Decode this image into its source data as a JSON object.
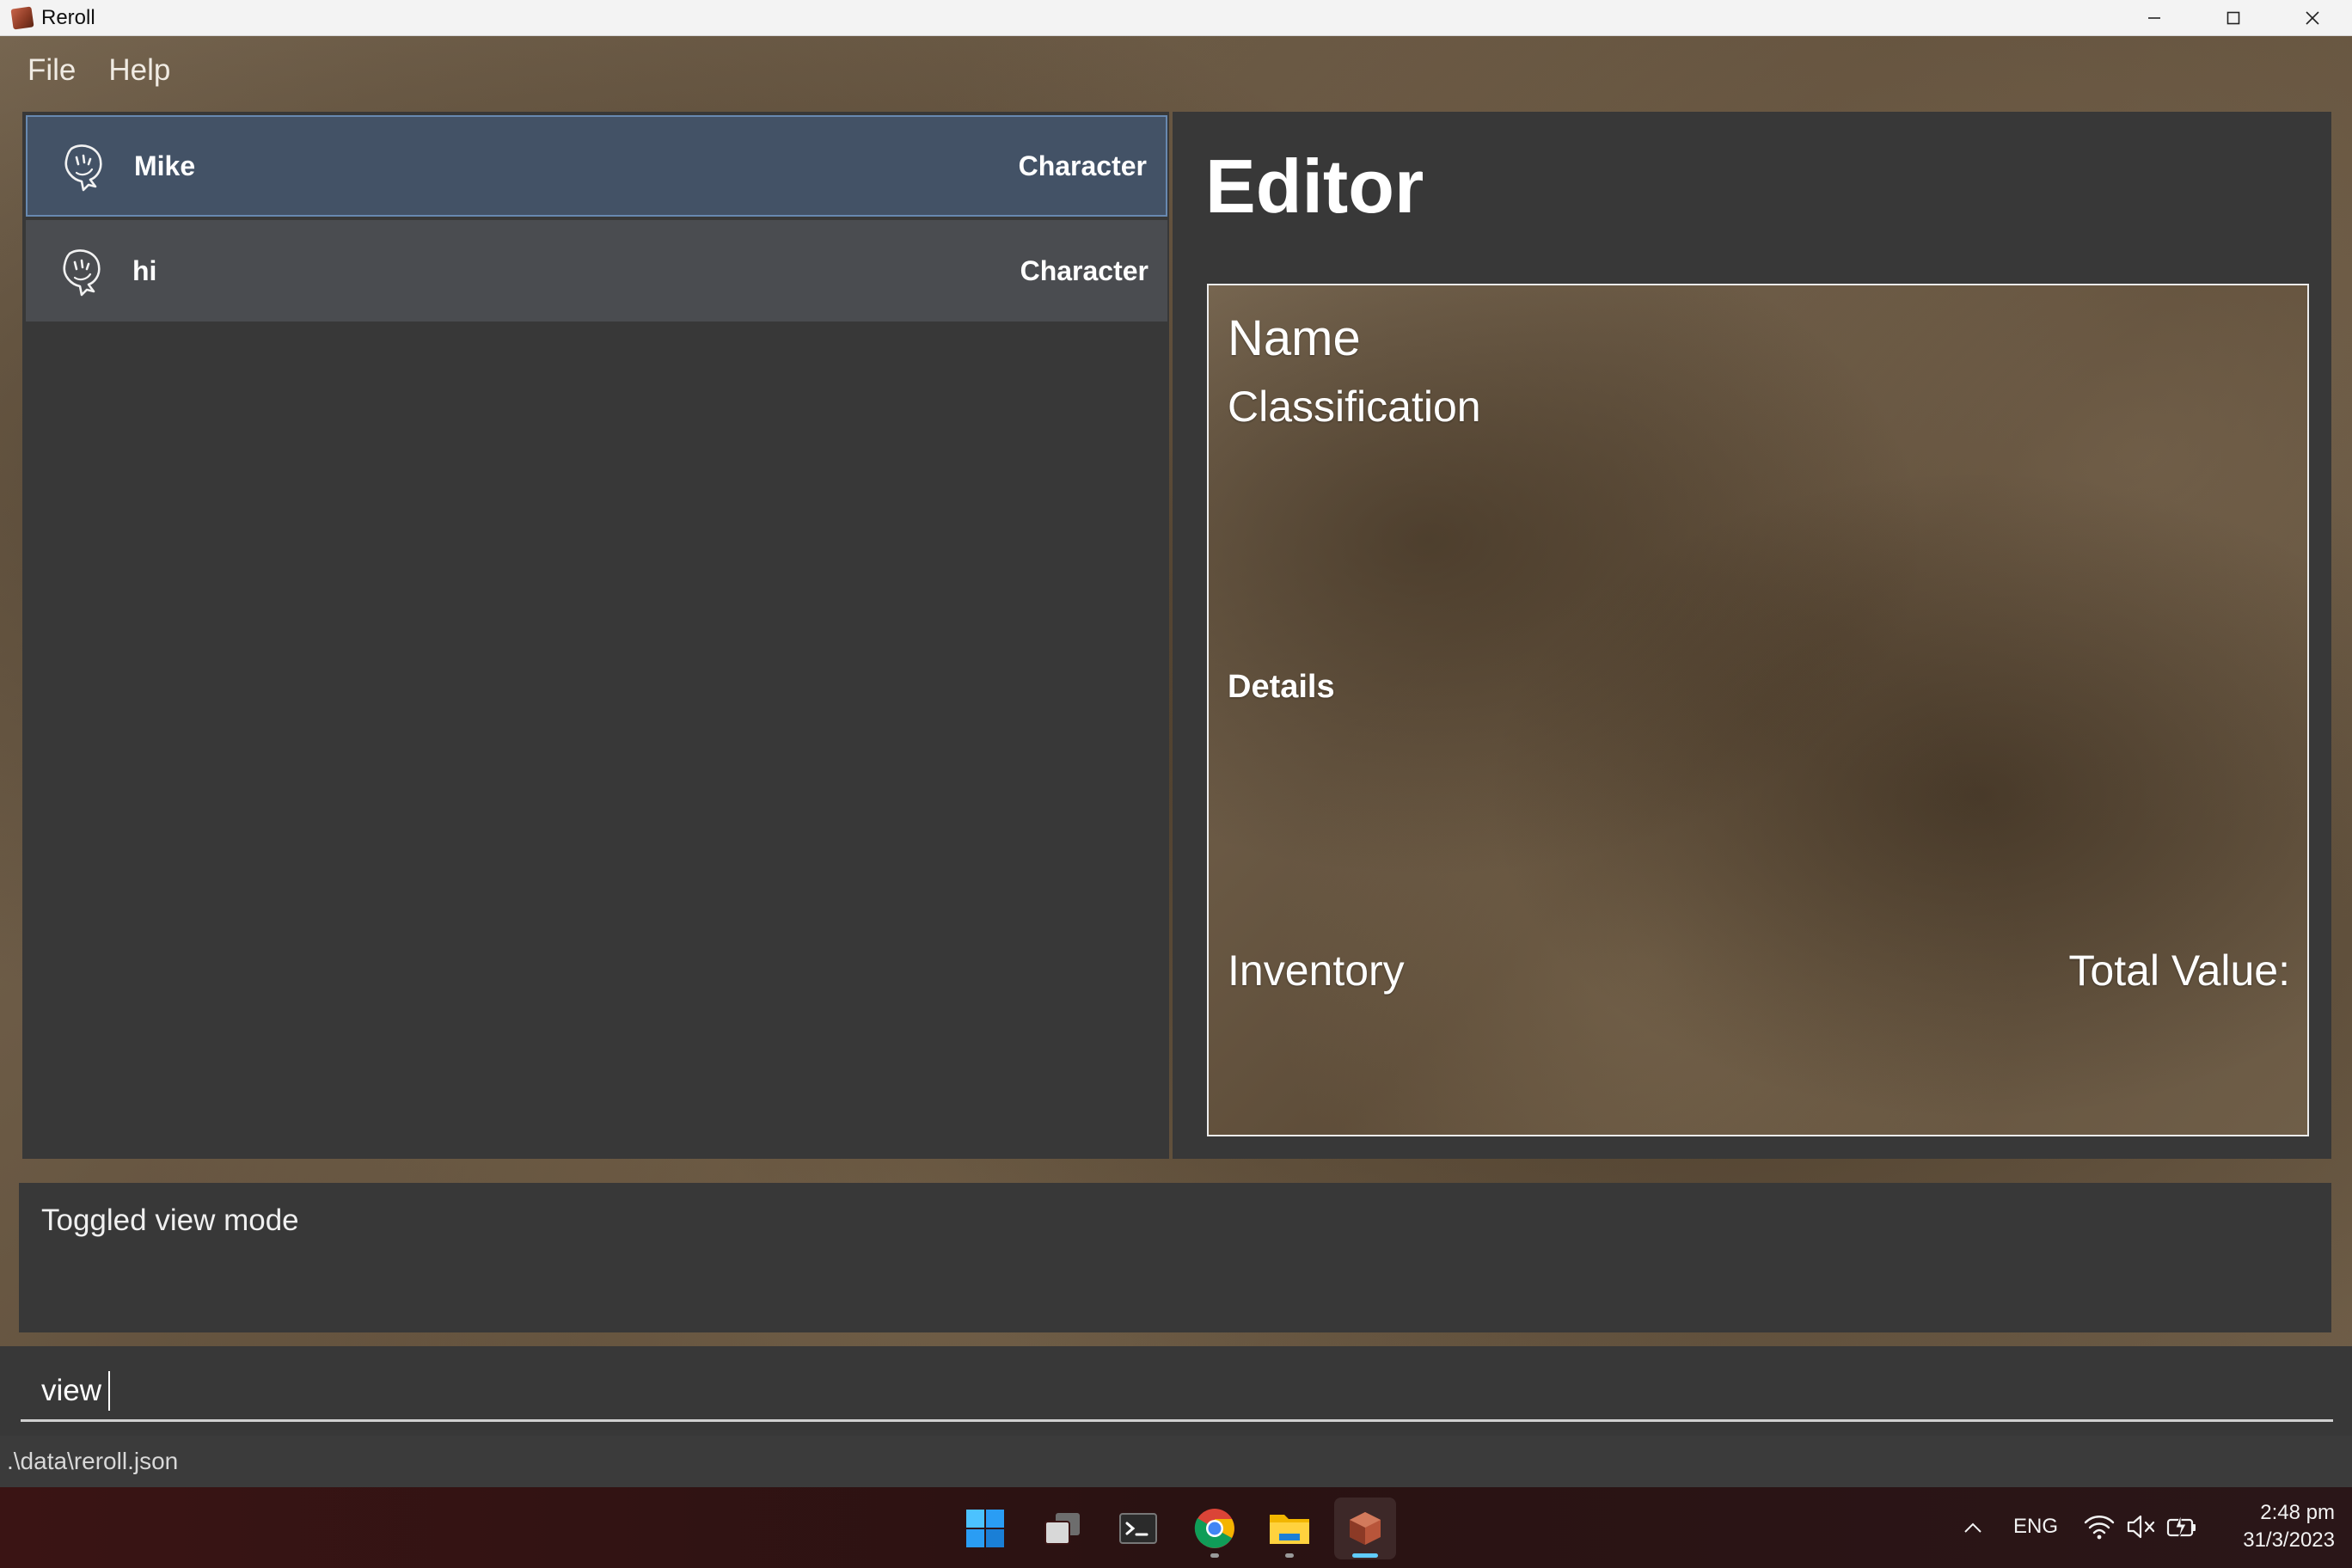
{
  "window": {
    "title": "Reroll",
    "controls": {
      "minimize": "—",
      "maximize": "☐",
      "close": "✕"
    }
  },
  "menu": {
    "file": "File",
    "help": "Help"
  },
  "list": {
    "items": [
      {
        "name": "Mike",
        "classification": "Character",
        "icon": "character-icon",
        "selected": true
      },
      {
        "name": "hi",
        "classification": "Character",
        "icon": "character-icon",
        "selected": false
      }
    ]
  },
  "editor": {
    "title": "Editor",
    "name_label": "Name",
    "classification_label": "Classification",
    "details_label": "Details",
    "inventory_label": "Inventory",
    "total_value_label": "Total Value:"
  },
  "result": {
    "message": "Toggled view mode"
  },
  "command": {
    "value": "view"
  },
  "status": {
    "file_path": ".\\data\\reroll.json"
  },
  "taskbar": {
    "apps": [
      "start-icon",
      "task-view-icon",
      "terminal-icon",
      "chrome-icon",
      "file-explorer-icon",
      "reroll-icon"
    ],
    "tray": {
      "language": "ENG",
      "time": "2:48 pm",
      "date": "31/3/2023"
    }
  },
  "colors": {
    "selected_row": "#435266",
    "selected_border": "#6889b0",
    "panel_bg": "#383838",
    "accent_indicator": "#60cdff"
  }
}
